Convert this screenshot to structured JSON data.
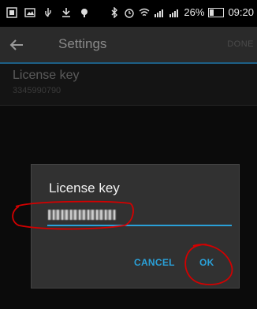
{
  "status_bar": {
    "battery": "26%",
    "time": "09:20",
    "battery_level": 0.26
  },
  "app_bar": {
    "title": "Settings",
    "done_label": "DONE"
  },
  "preference": {
    "title": "License key",
    "value": "3345990790"
  },
  "dialog": {
    "title": "License key",
    "input_value": "",
    "cancel_label": "CANCEL",
    "ok_label": "OK"
  },
  "colors": {
    "accent": "#2aa0d8",
    "annotation": "#d40000",
    "appbar_divider": "#1d5f86"
  }
}
